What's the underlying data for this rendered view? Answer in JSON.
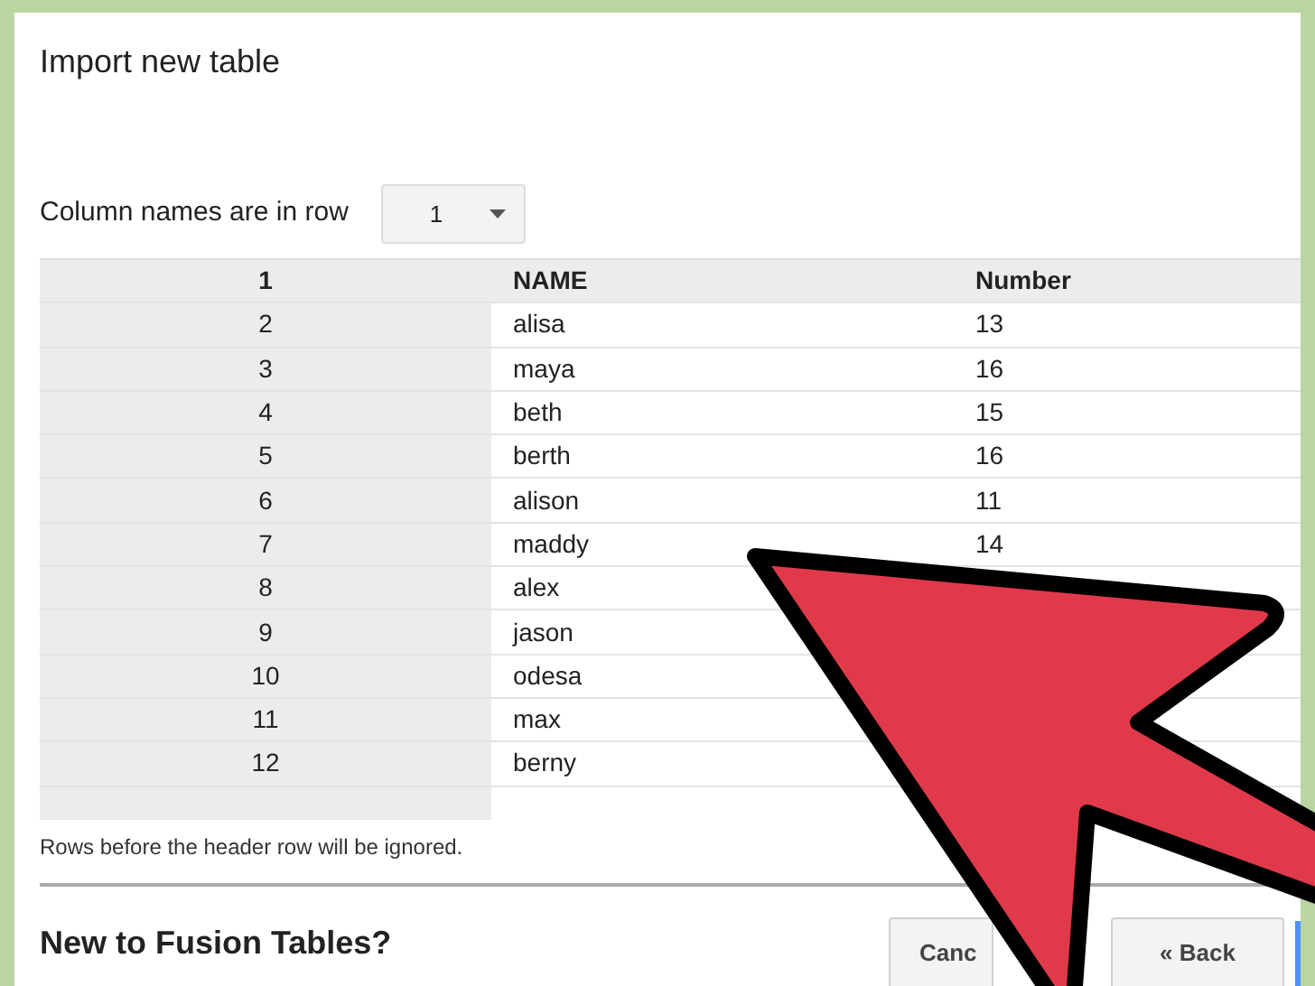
{
  "dialog": {
    "title": "Import new table"
  },
  "header_row_setting": {
    "label": "Column names are in row",
    "value": "1"
  },
  "table": {
    "columns": [
      "1",
      "NAME",
      "Number"
    ],
    "rows": [
      [
        "2",
        "alisa",
        "13"
      ],
      [
        "3",
        "maya",
        "16"
      ],
      [
        "4",
        "beth",
        "15"
      ],
      [
        "5",
        "berth",
        "16"
      ],
      [
        "6",
        "alison",
        "11"
      ],
      [
        "7",
        "maddy",
        "14"
      ],
      [
        "8",
        "alex",
        ""
      ],
      [
        "9",
        "jason",
        ""
      ],
      [
        "10",
        "odesa",
        ""
      ],
      [
        "11",
        "max",
        ""
      ],
      [
        "12",
        "berny",
        ""
      ]
    ]
  },
  "note": "Rows before the header row will be ignored.",
  "section_heading": "New to Fusion Tables?",
  "buttons": [
    "Canc",
    "« Back"
  ]
}
